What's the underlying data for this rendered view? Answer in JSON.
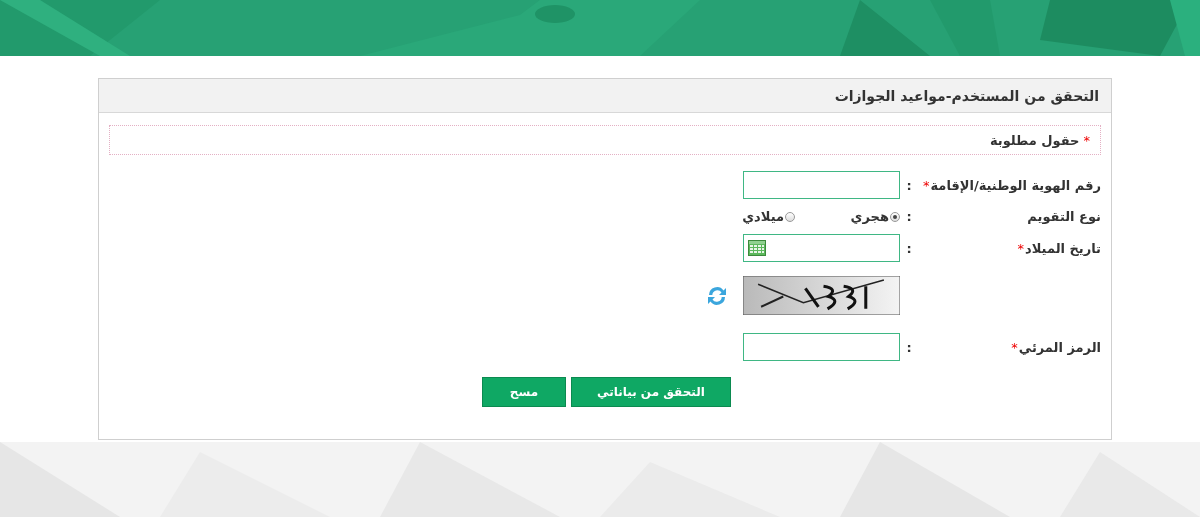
{
  "panel": {
    "title": "التحقق من المستخدم-مواعيد الجوازات"
  },
  "required_note": {
    "mark": "*",
    "text": "حقول مطلوبة"
  },
  "fields": [
    {
      "kind": "text",
      "label": "رقم الهوية الوطنية/الإقامة",
      "mark": "*",
      "separator": ":"
    },
    {
      "kind": "radio",
      "label": "نوع التقويم",
      "separator": ":",
      "options": [
        {
          "label": "هجري",
          "selected": true
        },
        {
          "label": "ميلادي",
          "selected": false
        }
      ]
    },
    {
      "kind": "date",
      "label": "تاريخ الميلاد",
      "mark": "*",
      "separator": ":"
    },
    {
      "kind": "captcha_image"
    },
    {
      "kind": "text",
      "label": "الرمز المرئي",
      "mark": "*",
      "separator": ":"
    }
  ],
  "buttons": [
    {
      "label": "التحقق من بياناتي"
    },
    {
      "label": "مسح"
    }
  ]
}
